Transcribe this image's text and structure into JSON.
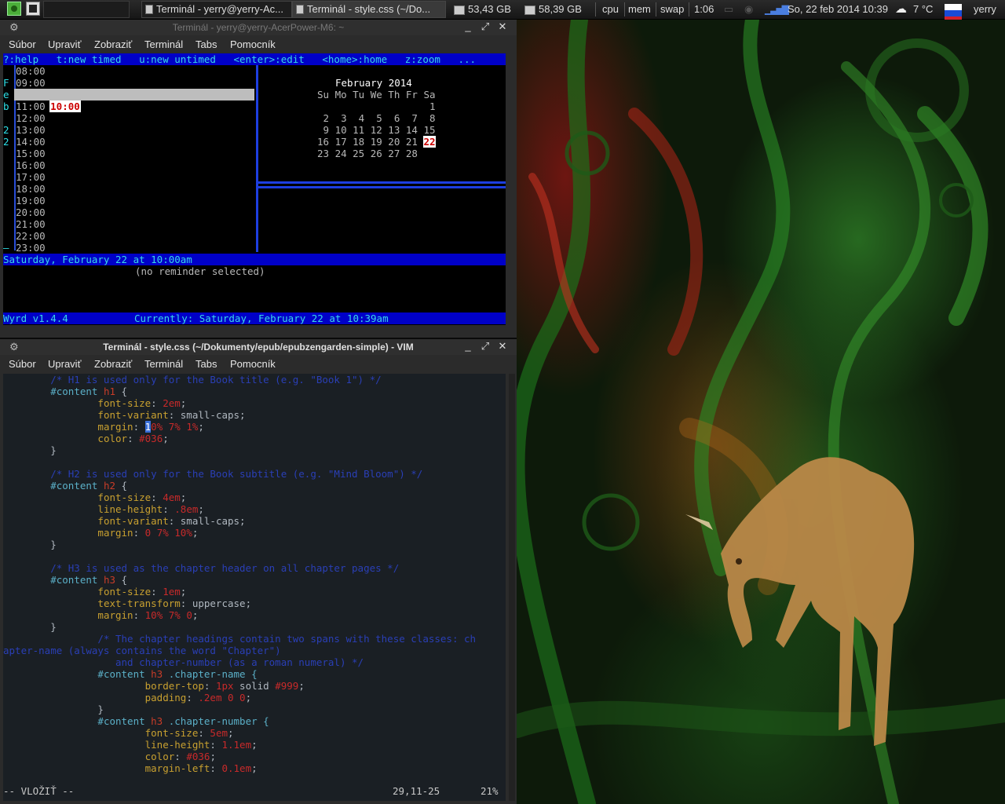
{
  "panel": {
    "task1": "Terminál - yerry@yerry-Ac...",
    "task2": "Terminál - style.css (~/Do...",
    "disk1": "53,43 GB",
    "disk2": "58,39 GB",
    "cpu": "cpu",
    "mem": "mem",
    "swap": "swap",
    "uptime": "1:06",
    "datetime": "So, 22 feb 2014 10:39",
    "weather": "7 °C",
    "user": "yerry"
  },
  "wyrd_window": {
    "title": "Terminál - yerry@yerry-AcerPower-M6: ~",
    "menu": [
      "Súbor",
      "Upraviť",
      "Zobraziť",
      "Terminál",
      "Tabs",
      "Pomocník"
    ],
    "help_bar": "?:help   t:new timed   u:new untimed   <enter>:edit   <home>:home   z:zoom   ...",
    "side_letters": [
      "F",
      "e",
      "b",
      "",
      "2",
      "2"
    ],
    "times": [
      "08:00",
      "09:00",
      "10:00",
      "11:00",
      "12:00",
      "13:00",
      "14:00",
      "15:00",
      "16:00",
      "17:00",
      "18:00",
      "19:00",
      "20:00",
      "21:00",
      "22:00",
      "23:00"
    ],
    "selected_time": "10:00",
    "calendar": {
      "month": "February 2014",
      "header": "Su Mo Tu We Th Fr Sa",
      "week1": "                   1",
      "week2": " 2  3  4  5  6  7  8",
      "week3": " 9 10 11 12 13 14 15",
      "week4_pre": "16 17 18 19 20 21 ",
      "today": "22",
      "week5": "23 24 25 26 27 28"
    },
    "status_line": "Saturday, February 22 at 10:00am",
    "reminder": "(no reminder selected)",
    "version": "Wyrd v1.4.4",
    "currently": "Currently: Saturday, February 22 at 10:39am"
  },
  "vim_window": {
    "title": "Terminál - style.css (~/Dokumenty/epub/epubzengarden-simple) - VIM",
    "menu": [
      "Súbor",
      "Upraviť",
      "Zobraziť",
      "Terminál",
      "Tabs",
      "Pomocník"
    ],
    "lines": [
      {
        "c": "        /* H1 is used only for the Book title (e.g. \"Book 1\") */",
        "t": "cm"
      },
      {
        "segs": [
          [
            "        ",
            "pl"
          ],
          [
            "#content ",
            "sel-c"
          ],
          [
            "h1",
            "kw"
          ],
          [
            " {",
            "pl"
          ]
        ]
      },
      {
        "segs": [
          [
            "                ",
            "pl"
          ],
          [
            "font-size",
            "prop"
          ],
          [
            ": ",
            "pl"
          ],
          [
            "2em",
            "num"
          ],
          [
            ";",
            "pl"
          ]
        ]
      },
      {
        "segs": [
          [
            "                ",
            "pl"
          ],
          [
            "font-variant",
            "prop"
          ],
          [
            ": small-caps;",
            "pl"
          ]
        ]
      },
      {
        "segs": [
          [
            "                ",
            "pl"
          ],
          [
            "margin",
            "prop"
          ],
          [
            ": ",
            "pl"
          ],
          [
            "1",
            "cursor"
          ],
          [
            "0% 7% 1%",
            "num"
          ],
          [
            ";",
            "pl"
          ]
        ]
      },
      {
        "segs": [
          [
            "                ",
            "pl"
          ],
          [
            "color",
            "prop"
          ],
          [
            ": ",
            "pl"
          ],
          [
            "#036",
            "num"
          ],
          [
            ";",
            "pl"
          ]
        ]
      },
      {
        "c": "        }",
        "t": "pl"
      },
      {
        "c": "",
        "t": "pl"
      },
      {
        "c": "        /* H2 is used only for the Book subtitle (e.g. \"Mind Bloom\") */",
        "t": "cm"
      },
      {
        "segs": [
          [
            "        ",
            "pl"
          ],
          [
            "#content ",
            "sel-c"
          ],
          [
            "h2",
            "kw"
          ],
          [
            " {",
            "pl"
          ]
        ]
      },
      {
        "segs": [
          [
            "                ",
            "pl"
          ],
          [
            "font-size",
            "prop"
          ],
          [
            ": ",
            "pl"
          ],
          [
            "4em",
            "num"
          ],
          [
            ";",
            "pl"
          ]
        ]
      },
      {
        "segs": [
          [
            "                ",
            "pl"
          ],
          [
            "line-height",
            "prop"
          ],
          [
            ": ",
            "pl"
          ],
          [
            ".8em",
            "num"
          ],
          [
            ";",
            "pl"
          ]
        ]
      },
      {
        "segs": [
          [
            "                ",
            "pl"
          ],
          [
            "font-variant",
            "prop"
          ],
          [
            ": small-caps;",
            "pl"
          ]
        ]
      },
      {
        "segs": [
          [
            "                ",
            "pl"
          ],
          [
            "margin",
            "prop"
          ],
          [
            ": ",
            "pl"
          ],
          [
            "0 7% 10%",
            "num"
          ],
          [
            ";",
            "pl"
          ]
        ]
      },
      {
        "c": "        }",
        "t": "pl"
      },
      {
        "c": "",
        "t": "pl"
      },
      {
        "c": "        /* H3 is used as the chapter header on all chapter pages */",
        "t": "cm"
      },
      {
        "segs": [
          [
            "        ",
            "pl"
          ],
          [
            "#content ",
            "sel-c"
          ],
          [
            "h3",
            "kw"
          ],
          [
            " {",
            "pl"
          ]
        ]
      },
      {
        "segs": [
          [
            "                ",
            "pl"
          ],
          [
            "font-size",
            "prop"
          ],
          [
            ": ",
            "pl"
          ],
          [
            "1em",
            "num"
          ],
          [
            ";",
            "pl"
          ]
        ]
      },
      {
        "segs": [
          [
            "                ",
            "pl"
          ],
          [
            "text-transform",
            "prop"
          ],
          [
            ": uppercase;",
            "pl"
          ]
        ]
      },
      {
        "segs": [
          [
            "                ",
            "pl"
          ],
          [
            "margin",
            "prop"
          ],
          [
            ": ",
            "pl"
          ],
          [
            "10% 7% 0",
            "num"
          ],
          [
            ";",
            "pl"
          ]
        ]
      },
      {
        "c": "        }",
        "t": "pl"
      },
      {
        "c": "                /* The chapter headings contain two spans with these classes: ch",
        "t": "cm"
      },
      {
        "c": "apter-name (always contains the word \"Chapter\")",
        "t": "cm"
      },
      {
        "c": "                   and chapter-number (as a roman numeral) */",
        "t": "cm"
      },
      {
        "segs": [
          [
            "                ",
            "pl"
          ],
          [
            "#content ",
            "sel-c"
          ],
          [
            "h3",
            "kw"
          ],
          [
            " .chapter-name {",
            "sel-c"
          ]
        ]
      },
      {
        "segs": [
          [
            "                        ",
            "pl"
          ],
          [
            "border-top",
            "prop"
          ],
          [
            ": ",
            "pl"
          ],
          [
            "1px",
            "num"
          ],
          [
            " solid ",
            "pl"
          ],
          [
            "#999",
            "num"
          ],
          [
            ";",
            "pl"
          ]
        ]
      },
      {
        "segs": [
          [
            "                        ",
            "pl"
          ],
          [
            "padding",
            "prop"
          ],
          [
            ": ",
            "pl"
          ],
          [
            ".2em 0 0",
            "num"
          ],
          [
            ";",
            "pl"
          ]
        ]
      },
      {
        "c": "                }",
        "t": "pl"
      },
      {
        "segs": [
          [
            "                ",
            "pl"
          ],
          [
            "#content ",
            "sel-c"
          ],
          [
            "h3",
            "kw"
          ],
          [
            " .chapter-number {",
            "sel-c"
          ]
        ]
      },
      {
        "segs": [
          [
            "                        ",
            "pl"
          ],
          [
            "font-size",
            "prop"
          ],
          [
            ": ",
            "pl"
          ],
          [
            "5em",
            "num"
          ],
          [
            ";",
            "pl"
          ]
        ]
      },
      {
        "segs": [
          [
            "                        ",
            "pl"
          ],
          [
            "line-height",
            "prop"
          ],
          [
            ": ",
            "pl"
          ],
          [
            "1.1em",
            "num"
          ],
          [
            ";",
            "pl"
          ]
        ]
      },
      {
        "segs": [
          [
            "                        ",
            "pl"
          ],
          [
            "color",
            "prop"
          ],
          [
            ": ",
            "pl"
          ],
          [
            "#036",
            "num"
          ],
          [
            ";",
            "pl"
          ]
        ]
      },
      {
        "segs": [
          [
            "                        ",
            "pl"
          ],
          [
            "margin-left",
            "prop"
          ],
          [
            ": ",
            "pl"
          ],
          [
            "0.1em",
            "num"
          ],
          [
            ";",
            "pl"
          ]
        ]
      }
    ],
    "mode": "-- VLOŽIŤ --",
    "position": "29,11-25",
    "percent": "21%"
  },
  "colors": {
    "accent_blue": "#0000c8",
    "cyan_text": "#2ee0e8",
    "vim_bg": "#1a1f24"
  }
}
